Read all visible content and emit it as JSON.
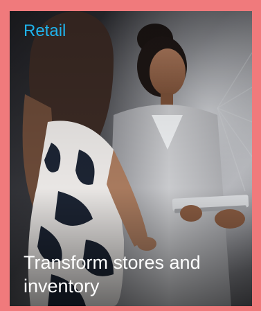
{
  "tile": {
    "category": "Retail",
    "caption": "Transform stores and inventory"
  },
  "image": {
    "subject": "Two women talking, one holding a tablet"
  },
  "colors": {
    "page_background": "#f07a7c",
    "category_text": "#1fb3ec",
    "caption_text": "#ffffff"
  }
}
